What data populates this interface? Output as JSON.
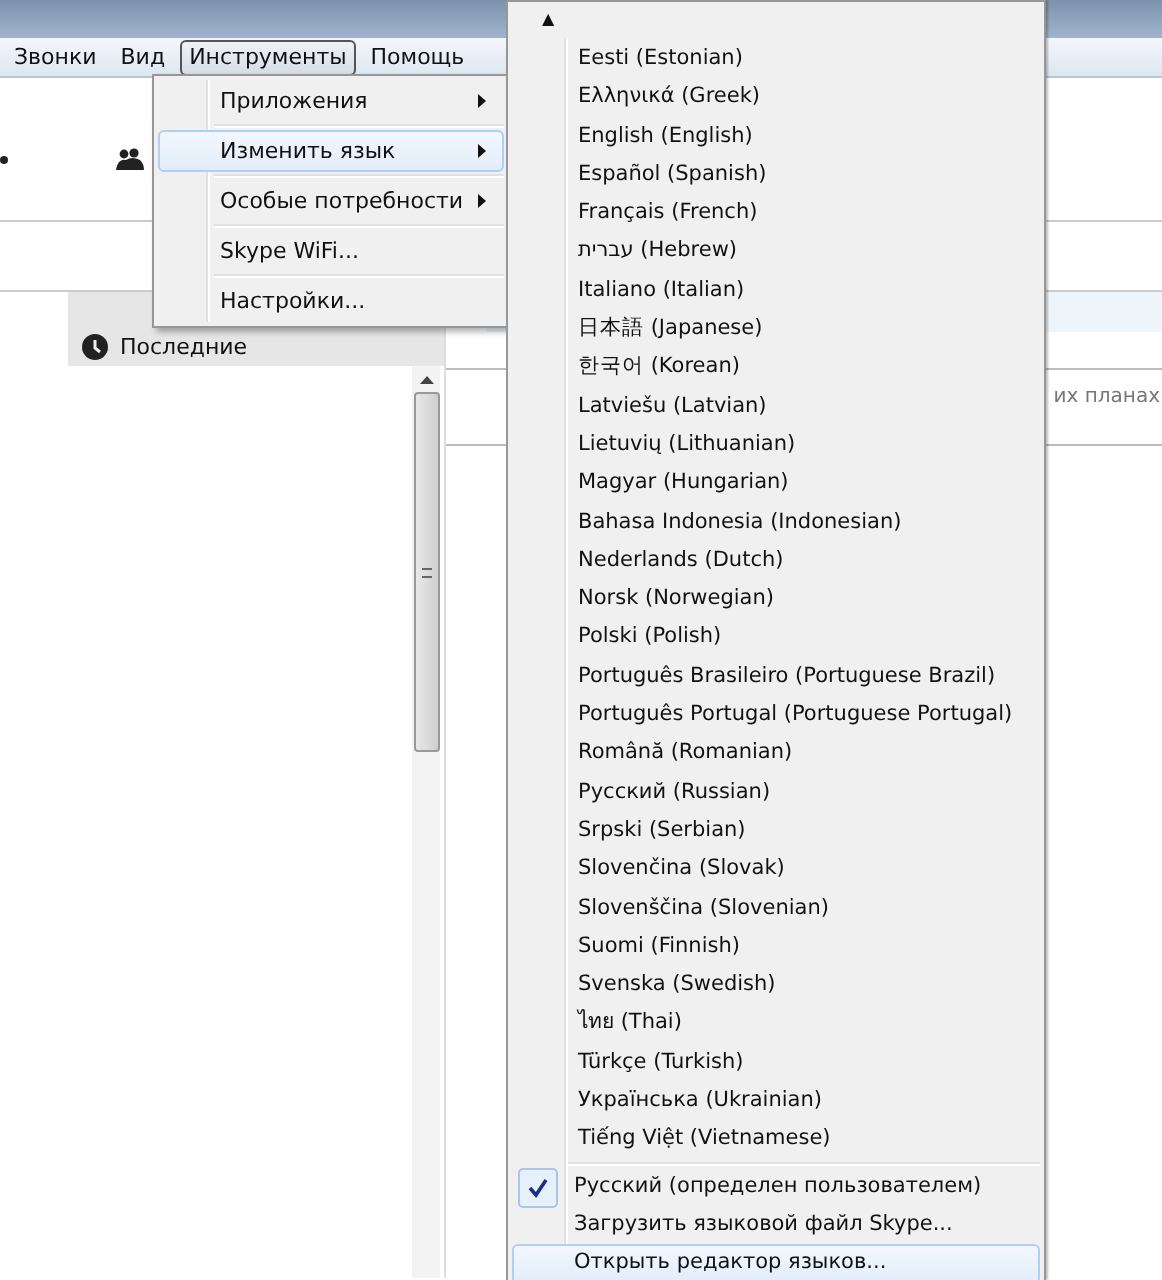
{
  "menu_bar": [
    {
      "label": "Звонки",
      "selected": false
    },
    {
      "label": "Вид",
      "selected": false
    },
    {
      "label": "Инструменты",
      "selected": true
    },
    {
      "label": "Помощь",
      "selected": false
    }
  ],
  "tools_menu": [
    {
      "label": "Приложения",
      "submenu": true,
      "highlighted": false
    },
    {
      "label": "Изменить язык",
      "submenu": true,
      "highlighted": true
    },
    {
      "label": "Особые потребности",
      "submenu": true,
      "highlighted": false
    },
    {
      "label": "Skype WiFi...",
      "submenu": false,
      "highlighted": false
    },
    {
      "label": "Настройки...",
      "submenu": false,
      "highlighted": false
    }
  ],
  "background": {
    "tab_label": "Последние",
    "side_text": "их планах"
  },
  "language_menu": {
    "scroll_up": "▲",
    "languages": [
      "Eesti (Estonian)",
      "Ελληνικά (Greek)",
      "English (English)",
      "Español (Spanish)",
      "Français (French)",
      "עברית (Hebrew)",
      "Italiano (Italian)",
      "日本語 (Japanese)",
      "한국어 (Korean)",
      "Latviešu (Latvian)",
      "Lietuvių (Lithuanian)",
      "Magyar (Hungarian)",
      "Bahasa Indonesia (Indonesian)",
      "Nederlands (Dutch)",
      "Norsk (Norwegian)",
      "Polski (Polish)",
      "Português Brasileiro (Portuguese Brazil)",
      "Português Portugal (Portuguese Portugal)",
      "Română (Romanian)",
      "Русский (Russian)",
      "Srpski (Serbian)",
      "Slovenčina (Slovak)",
      "Slovenščina (Slovenian)",
      "Suomi (Finnish)",
      "Svenska (Swedish)",
      "ไทย (Thai)",
      "Türkçe (Turkish)",
      "Українська (Ukrainian)",
      "Tiếng Việt (Vietnamese)"
    ],
    "actions": [
      {
        "label": "Русский (определен пользователем)",
        "checked": true,
        "highlighted": false
      },
      {
        "label": "Загрузить языковой файл Skype...",
        "checked": false,
        "highlighted": false
      },
      {
        "label": "Открыть редактор языков...",
        "checked": false,
        "highlighted": true
      }
    ]
  }
}
